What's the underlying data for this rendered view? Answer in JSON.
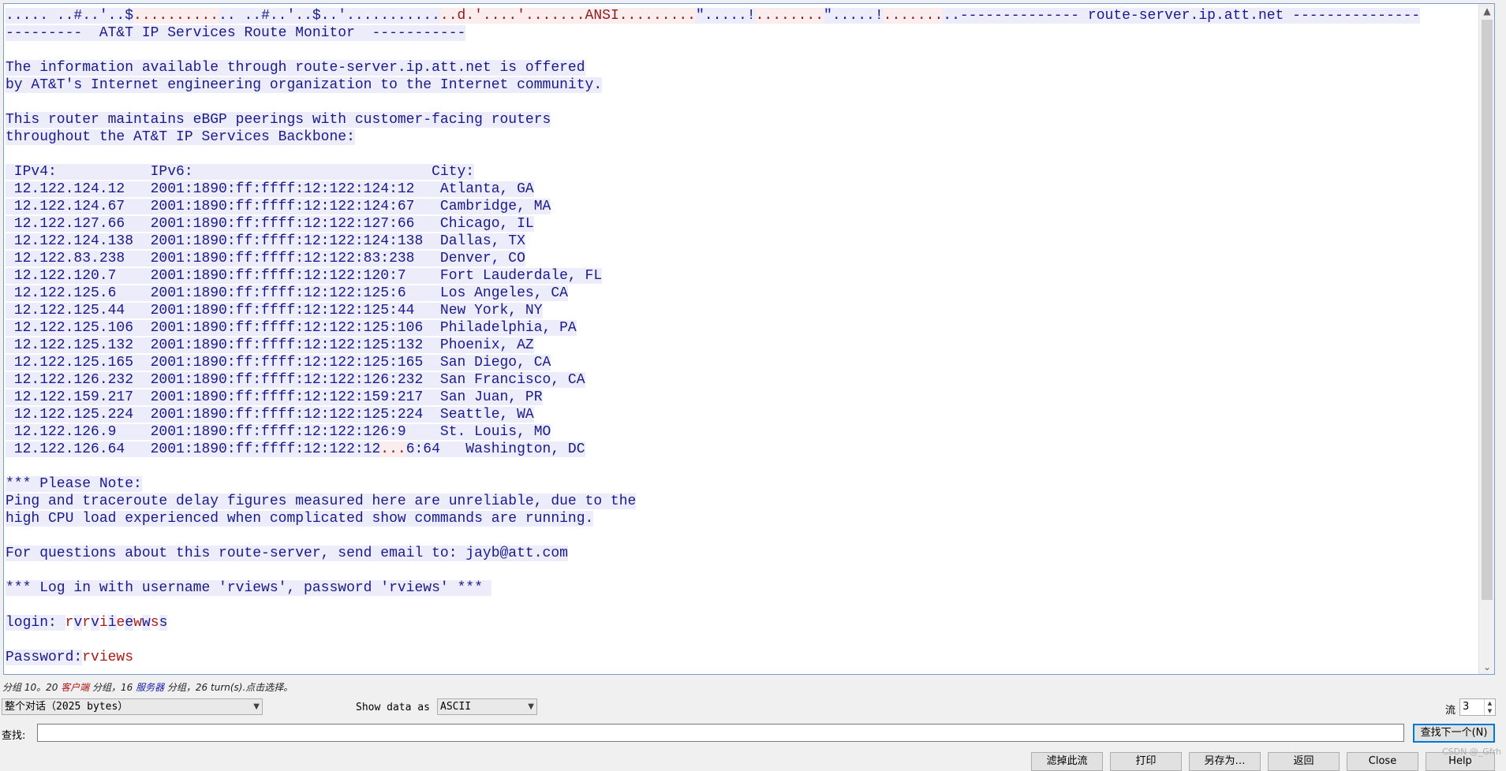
{
  "conversation": [
    [
      {
        "d": "s",
        "t": "..... ..#..'..$"
      },
      {
        "d": "c",
        "t": ".........."
      },
      {
        "d": "s",
        "t": ".. ..#..'..$..'..........."
      },
      {
        "d": "c",
        "t": "..d.'....'.......ANSI........."
      },
      {
        "d": "s",
        "t": "\".....!"
      },
      {
        "d": "c",
        "t": "........"
      },
      {
        "d": "s",
        "t": "\".....!"
      },
      {
        "d": "c",
        "t": "......."
      },
      {
        "d": "s",
        "t": "..-------------- route-server.ip.att.net ---------------"
      }
    ],
    [
      {
        "d": "s",
        "t": "---------  AT&T IP Services Route Monitor  -----------"
      }
    ],
    [],
    [
      {
        "d": "s",
        "t": "The information available through route-server.ip.att.net is offered"
      }
    ],
    [
      {
        "d": "s",
        "t": "by AT&T's Internet engineering organization to the Internet community."
      }
    ],
    [],
    [
      {
        "d": "s",
        "t": "This router maintains eBGP peerings with customer-facing routers"
      }
    ],
    [
      {
        "d": "s",
        "t": "throughout the AT&T IP Services Backbone:"
      }
    ],
    [],
    [
      {
        "d": "s",
        "t": " IPv4:           IPv6:                            City:"
      }
    ],
    [
      {
        "d": "s",
        "t": " 12.122.124.12   2001:1890:ff:ffff:12:122:124:12   Atlanta, GA"
      }
    ],
    [
      {
        "d": "s",
        "t": " 12.122.124.67   2001:1890:ff:ffff:12:122:124:67   Cambridge, MA"
      }
    ],
    [
      {
        "d": "s",
        "t": " 12.122.127.66   2001:1890:ff:ffff:12:122:127:66   Chicago, IL"
      }
    ],
    [
      {
        "d": "s",
        "t": " 12.122.124.138  2001:1890:ff:ffff:12:122:124:138  Dallas, TX"
      }
    ],
    [
      {
        "d": "s",
        "t": " 12.122.83.238   2001:1890:ff:ffff:12:122:83:238   Denver, CO"
      }
    ],
    [
      {
        "d": "s",
        "t": " 12.122.120.7    2001:1890:ff:ffff:12:122:120:7    Fort Lauderdale, FL"
      }
    ],
    [
      {
        "d": "s",
        "t": " 12.122.125.6    2001:1890:ff:ffff:12:122:125:6    Los Angeles, CA"
      }
    ],
    [
      {
        "d": "s",
        "t": " 12.122.125.44   2001:1890:ff:ffff:12:122:125:44   New York, NY"
      }
    ],
    [
      {
        "d": "s",
        "t": " 12.122.125.106  2001:1890:ff:ffff:12:122:125:106  Philadelphia, PA"
      }
    ],
    [
      {
        "d": "s",
        "t": " 12.122.125.132  2001:1890:ff:ffff:12:122:125:132  Phoenix, AZ"
      }
    ],
    [
      {
        "d": "s",
        "t": " 12.122.125.165  2001:1890:ff:ffff:12:122:125:165  San Diego, CA"
      }
    ],
    [
      {
        "d": "s",
        "t": " 12.122.126.232  2001:1890:ff:ffff:12:122:126:232  San Francisco, CA"
      }
    ],
    [
      {
        "d": "s",
        "t": " 12.122.159.217  2001:1890:ff:ffff:12:122:159:217  San Juan, PR"
      }
    ],
    [
      {
        "d": "s",
        "t": " 12.122.125.224  2001:1890:ff:ffff:12:122:125:224  Seattle, WA"
      }
    ],
    [
      {
        "d": "s",
        "t": " 12.122.126.9    2001:1890:ff:ffff:12:122:126:9    St. Louis, MO"
      }
    ],
    [
      {
        "d": "s",
        "t": " 12.122.126.64   2001:1890:ff:ffff:12:122:12"
      },
      {
        "d": "c",
        "t": "..."
      },
      {
        "d": "s",
        "t": "6:64   Washington, DC"
      }
    ],
    [],
    [
      {
        "d": "s",
        "t": "*** Please Note:"
      }
    ],
    [
      {
        "d": "s",
        "t": "Ping and traceroute delay figures measured here are unreliable, due to the"
      }
    ],
    [
      {
        "d": "s",
        "t": "high CPU load experienced when complicated show commands are running."
      }
    ],
    [],
    [
      {
        "d": "s",
        "t": "For questions about this route-server, send email to: jayb@att.com"
      }
    ],
    [],
    [
      {
        "d": "s",
        "t": "*** Log in with username 'rviews', password 'rviews' *** "
      }
    ],
    [],
    [
      {
        "d": "s",
        "t": "login: "
      },
      {
        "d": "cp",
        "t": "r"
      },
      {
        "d": "s",
        "t": "v"
      },
      {
        "d": "cp",
        "t": "r"
      },
      {
        "d": "s",
        "t": "v"
      },
      {
        "d": "cp",
        "t": "i"
      },
      {
        "d": "s",
        "t": "i"
      },
      {
        "d": "cp",
        "t": "e"
      },
      {
        "d": "s",
        "t": "e"
      },
      {
        "d": "cp",
        "t": "w"
      },
      {
        "d": "s",
        "t": "w"
      },
      {
        "d": "cp",
        "t": "s"
      },
      {
        "d": "s",
        "t": "s"
      }
    ],
    [],
    [
      {
        "d": "s",
        "t": "Password:"
      },
      {
        "d": "cp",
        "t": "rviews"
      }
    ]
  ],
  "status": {
    "part1": "分组 10。20 ",
    "client": "客户端",
    "part2": " 分组，16 ",
    "server": "服务器",
    "part3": " 分组，26 turn(s).点击选择。"
  },
  "conversation_select": {
    "value": "整个对话（2025 bytes）"
  },
  "show_data": {
    "label": "Show data as",
    "value": "ASCII"
  },
  "stream": {
    "label": "流",
    "value": "3"
  },
  "find": {
    "label": "查找:",
    "value": "",
    "next_button": "查找下一个(N)"
  },
  "buttons": {
    "filter_out": "滤掉此流",
    "print": "打印",
    "save_as": "另存为…",
    "back": "返回",
    "close": "Close",
    "help": "Help"
  },
  "watermark": "CSDN @_Gfrh"
}
